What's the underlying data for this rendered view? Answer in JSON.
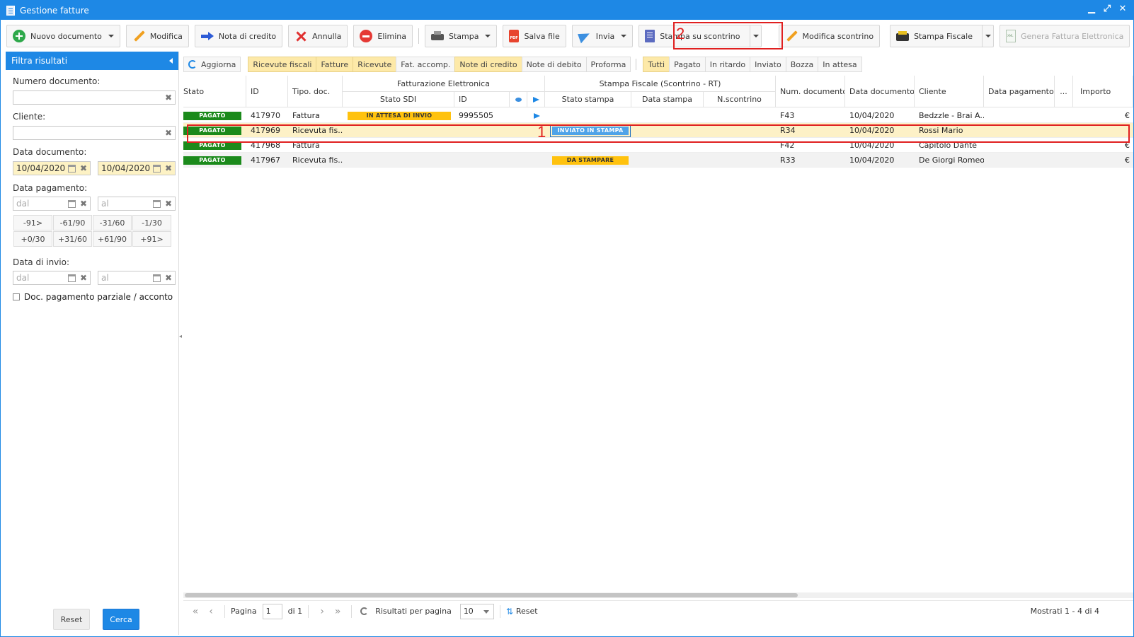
{
  "window": {
    "title": "Gestione fatture",
    "controls": [
      "▁",
      "⤢",
      "✕"
    ]
  },
  "toolbar": {
    "new_document": "Nuovo documento",
    "edit": "Modifica",
    "credit_note": "Nota di credito",
    "cancel": "Annulla",
    "delete": "Elimina",
    "print": "Stampa",
    "save_file": "Salva file",
    "send": "Invia",
    "print_receipt": "Stampa su scontrino",
    "edit_receipt": "Modifica scontrino",
    "fiscal_print": "Stampa Fiscale",
    "generate_einvoice": "Genera Fattura Elettronica"
  },
  "callouts": {
    "row": "1",
    "button": "2"
  },
  "sidebar": {
    "title": "Filtra risultati",
    "doc_number_label": "Numero documento:",
    "doc_number_value": "",
    "client_label": "Cliente:",
    "client_value": "",
    "doc_date_label": "Data documento:",
    "doc_date_from": "10/04/2020",
    "doc_date_to": "10/04/2020",
    "payment_date_label": "Data pagamento:",
    "from_placeholder": "dal",
    "to_placeholder": "al",
    "ranges": [
      "-91>",
      "-61/90",
      "-31/60",
      "-1/30",
      "+0/30",
      "+31/60",
      "+61/90",
      "+91>"
    ],
    "send_date_label": "Data di invio:",
    "partial_payment_label": "Doc. pagamento parziale / acconto",
    "reset": "Reset",
    "search": "Cerca"
  },
  "filters": {
    "refresh": "Aggiorna",
    "doc_types": [
      {
        "label": "Ricevute fiscali",
        "active": true
      },
      {
        "label": "Fatture",
        "active": true
      },
      {
        "label": "Ricevute",
        "active": true
      },
      {
        "label": "Fat. accomp.",
        "active": false
      },
      {
        "label": "Note di credito",
        "active": true
      },
      {
        "label": "Note di debito",
        "active": false
      },
      {
        "label": "Proforma",
        "active": false
      }
    ],
    "statuses": [
      {
        "label": "Tutti",
        "active": true
      },
      {
        "label": "Pagato",
        "active": false
      },
      {
        "label": "In ritardo",
        "active": false
      },
      {
        "label": "Inviato",
        "active": false
      },
      {
        "label": "Bozza",
        "active": false
      },
      {
        "label": "In attesa",
        "active": false
      }
    ]
  },
  "grid": {
    "headers": {
      "status": "Stato",
      "id": "ID",
      "doc_type": "Tipo. doc.",
      "einvoice_group": "Fatturazione Elettronica",
      "sdi_status": "Stato SDI",
      "sdi_id": "ID",
      "fiscal_group": "Stampa Fiscale (Scontrino - RT)",
      "print_status": "Stato stampa",
      "print_date": "Data stampa",
      "receipt_number": "N.scontrino",
      "doc_number": "Num. documento",
      "doc_date": "Data documento",
      "client": "Cliente",
      "payment_date": "Data pagamento",
      "more": "...",
      "amount": "Importo"
    },
    "rows": [
      {
        "status": "PAGATO",
        "id": "417970",
        "type": "Fattura",
        "sdi_status": "IN ATTESA DI INVIO",
        "sdi_id": "9995505",
        "flag": true,
        "print_status": "",
        "print_date": "",
        "receipt": "",
        "number": "F43",
        "date": "10/04/2020",
        "client": "Bedzzle - Brai A...",
        "payment_date": "",
        "amount": "€"
      },
      {
        "status": "PAGATO",
        "id": "417969",
        "type": "Ricevuta fis...",
        "sdi_status": "",
        "sdi_id": "",
        "flag": false,
        "print_status": "INVIATO IN STAMPA",
        "print_date": "",
        "receipt": "",
        "number": "R34",
        "date": "10/04/2020",
        "client": "Rossi Mario",
        "payment_date": "",
        "amount": ""
      },
      {
        "status": "PAGATO",
        "id": "417968",
        "type": "Fattura",
        "sdi_status": "",
        "sdi_id": "",
        "flag": false,
        "print_status": "",
        "print_date": "",
        "receipt": "",
        "number": "F42",
        "date": "10/04/2020",
        "client": "Capitolo Dante",
        "payment_date": "",
        "amount": "€"
      },
      {
        "status": "PAGATO",
        "id": "417967",
        "type": "Ricevuta fis...",
        "sdi_status": "",
        "sdi_id": "",
        "flag": false,
        "print_status": "DA STAMPARE",
        "print_date": "",
        "receipt": "",
        "number": "R33",
        "date": "10/04/2020",
        "client": "De Giorgi Romeo",
        "payment_date": "",
        "amount": "€"
      }
    ]
  },
  "pager": {
    "page_label": "Pagina",
    "page_value": "1",
    "of_label": "di 1",
    "per_page_label": "Risultati per pagina",
    "per_page_value": "10",
    "reset": "Reset",
    "summary": "Mostrati 1 - 4 di 4"
  },
  "colors": {
    "accent": "#1e88e5",
    "paid": "#1b8a1b",
    "pending": "#ffc20e",
    "callout": "#e02020",
    "selected_row": "#fdf1c7"
  }
}
